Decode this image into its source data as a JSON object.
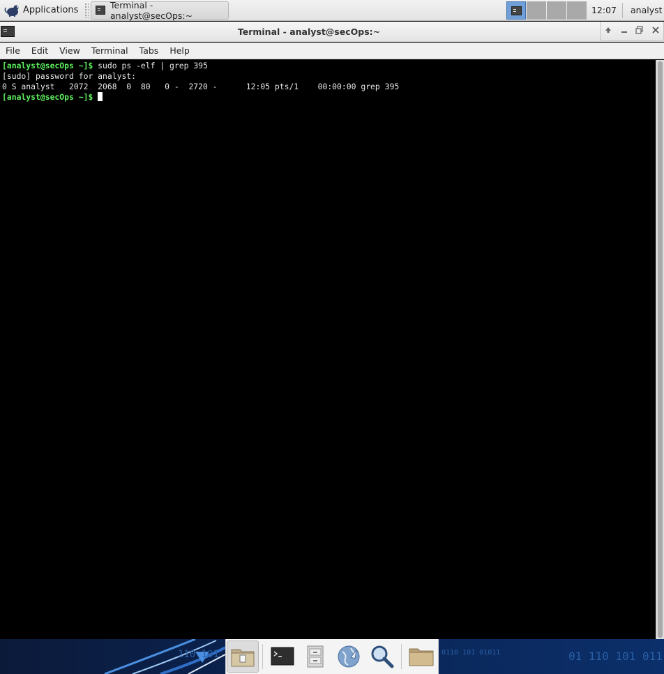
{
  "top_panel": {
    "applications_label": "Applications",
    "task_title": "Terminal - analyst@secOps:~",
    "clock": "12:07",
    "user": "analyst"
  },
  "window": {
    "title": "Terminal - analyst@secOps:~",
    "controls": [
      "up-arrow-icon",
      "minimize-icon",
      "maximize-icon",
      "close-icon"
    ]
  },
  "menubar": {
    "items": [
      "File",
      "Edit",
      "View",
      "Terminal",
      "Tabs",
      "Help"
    ]
  },
  "terminal": {
    "prompt": "[analyst@secOps ~]$",
    "line1_cmd": " sudo ps -elf | grep 395",
    "line2": "[sudo] password for analyst:",
    "line3": "0 S analyst   2072  2068  0  80   0 -  2720 -      12:05 pts/1    00:00:00 grep 395",
    "line4_prompt": "[analyst@secOps ~]$"
  },
  "dock": {
    "items": [
      "file-manager-icon",
      "terminal-icon",
      "file-cabinet-icon",
      "web-browser-icon",
      "search-icon",
      "folder-icon"
    ]
  },
  "wallpaper_text": {
    "left": "110 101",
    "mid": "0110 101 01011",
    "right": "01 110 101 011"
  },
  "colors": {
    "prompt_green": "#5ff25f",
    "terminal_bg": "#000000",
    "panel_bg": "#e8e8e8"
  }
}
